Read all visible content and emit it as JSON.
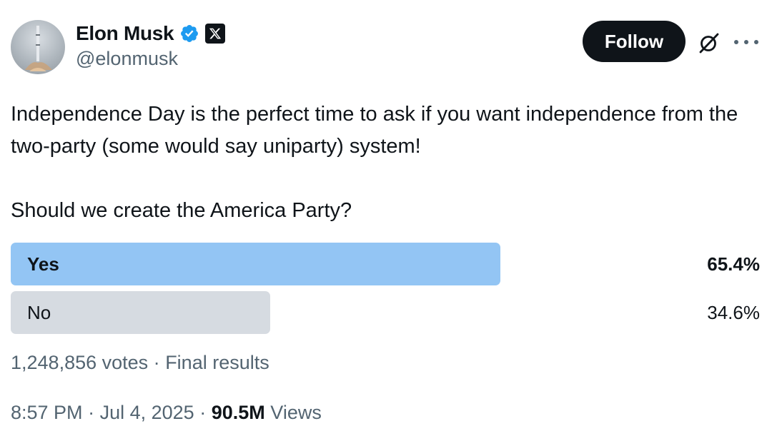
{
  "author": {
    "name": "Elon Musk",
    "handle": "@elonmusk",
    "verified_icon": "verified-badge-icon",
    "affiliate_icon": "x-logo-icon",
    "avatar_icon": "rocket-launch-avatar"
  },
  "actions": {
    "follow_label": "Follow",
    "grok_icon": "grok-icon",
    "more_icon": "more-dots-icon"
  },
  "tweet": {
    "text_1": "Independence Day is the perfect time to ask if you want independence from the two-party (some would say uniparty) system!",
    "text_2": "Should we create the America Party?"
  },
  "poll": {
    "options": [
      {
        "label": "Yes",
        "percent_label": "65.4%",
        "fraction": 0.654,
        "color": "#93c5f4",
        "winner": true
      },
      {
        "label": "No",
        "percent_label": "34.6%",
        "fraction": 0.346,
        "color": "#d6dbe1",
        "winner": false
      }
    ],
    "votes": "1,248,856 votes",
    "separator": "·",
    "status": "Final results"
  },
  "meta": {
    "time": "8:57 PM",
    "separator": "·",
    "date": "Jul 4, 2025",
    "views_count": "90.5M",
    "views_label": "Views"
  },
  "colors": {
    "text_primary": "#0f1419",
    "text_secondary": "#536471",
    "verified_blue": "#1d9bf0"
  }
}
